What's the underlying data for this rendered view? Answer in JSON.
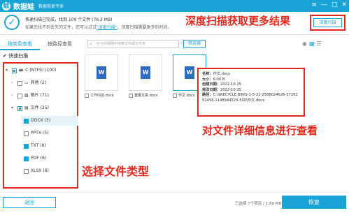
{
  "titlebar": {
    "app_name": "数据蛙",
    "subtitle": "数据恢复专家",
    "logo_glyph": "蛙",
    "win_controls": [
      "≡",
      "—",
      "□",
      "✕"
    ]
  },
  "header": {
    "status_line1": "快速扫描已完成，找到 109 个文件 (76.2 MB)",
    "status_line2_pre": "如果您找不到丢失的文件，您可以试试",
    "status_line2_link": "\"深度扫描\"",
    "status_line2_post": "，深度扫描需要更多的时间。",
    "deep_scan_button": "深度扫描",
    "annotation": "深度扫描获取更多结果"
  },
  "tabs": {
    "by_type": "按类型查看",
    "by_path": "按路径查看"
  },
  "quick_scan_label": "快速扫描",
  "tree": [
    {
      "label": "C:(NTFS) (100)",
      "check": "part",
      "arrow": "▾"
    },
    {
      "label": "其他 (2)",
      "check": "off",
      "arrow": "›"
    },
    {
      "label": "图片 (71)",
      "check": "off",
      "arrow": "›"
    },
    {
      "label": "文件 (25)",
      "check": "part",
      "arrow": "▾"
    },
    {
      "label": "DOCX (3)",
      "check": "on",
      "arrow": ""
    },
    {
      "label": "PPTX (5)",
      "check": "off",
      "arrow": ""
    },
    {
      "label": "TXT (6)",
      "check": "on",
      "arrow": ""
    },
    {
      "label": "PDF (6)",
      "check": "on",
      "arrow": ""
    },
    {
      "label": "XLSX (6)",
      "check": "off",
      "arrow": ""
    }
  ],
  "tree_annotation": "选择文件类型",
  "toolbar": {
    "search_placeholder": "在当前视图中搜索文件或文件夹",
    "filter_button": "筛选器",
    "view_icons": [
      "◉",
      "▦",
      "☰"
    ]
  },
  "files": [
    {
      "name": "工作内容.docx",
      "glyph": "W"
    },
    {
      "name": "重要文章.docx",
      "glyph": "W"
    },
    {
      "name": "作文.docx",
      "glyph": "W"
    }
  ],
  "file_info": {
    "name_label": "名称：",
    "name": "作文.docx",
    "size_label": "大小：",
    "size": "6.00 B",
    "created_label": "创建日期：",
    "created": "2022-10-25",
    "modified_label": "修改日期：",
    "modified": "2022-10-25",
    "path_label": "路径：",
    "path": "C:\\$RECYCLE.BIN\\S-1-5-21-2588024626-3726252456-1148944520-500\\作文.docx"
  },
  "info_annotation": "对文件详细信息进行查看",
  "footer": {
    "back_button": "返回",
    "selected": "已选择 7个项目 / 1.89 MB",
    "restore_button": "恢复"
  },
  "colors": {
    "accent": "#1aa3d6",
    "annotation": "#e4281d"
  }
}
